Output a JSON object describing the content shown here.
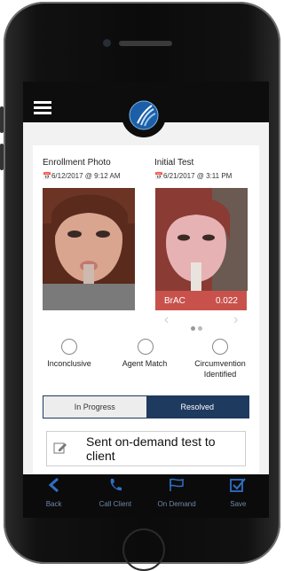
{
  "header": {
    "menu_icon": "hamburger-icon",
    "logo": "app-logo"
  },
  "enrollment": {
    "title": "Enrollment Photo",
    "date": "6/12/2017 @ 9:12 AM",
    "icon": "calendar-icon"
  },
  "initial": {
    "title": "Initial Test",
    "date": "6/21/2017 @ 3:11 PM",
    "icon": "calendar-icon",
    "brac_label": "BrAC",
    "brac_value": "0.022",
    "brac_color": "#c9514c"
  },
  "pager": {
    "prev": "‹",
    "next": "›"
  },
  "options": [
    {
      "label": "Inconclusive"
    },
    {
      "label": "Agent Match"
    },
    {
      "label": "Circumvention Identified"
    }
  ],
  "status": {
    "in_progress": "In Progress",
    "resolved": "Resolved",
    "selected": "Resolved",
    "accent": "#1f3a5f"
  },
  "note": {
    "text": "Sent on-demand test to client",
    "icon": "edit-icon"
  },
  "tabs": [
    {
      "label": "Back",
      "icon": "back-icon"
    },
    {
      "label": "Call Client",
      "icon": "phone-icon"
    },
    {
      "label": "On Demand",
      "icon": "flag-icon"
    },
    {
      "label": "Save",
      "icon": "checkbox-icon"
    }
  ]
}
